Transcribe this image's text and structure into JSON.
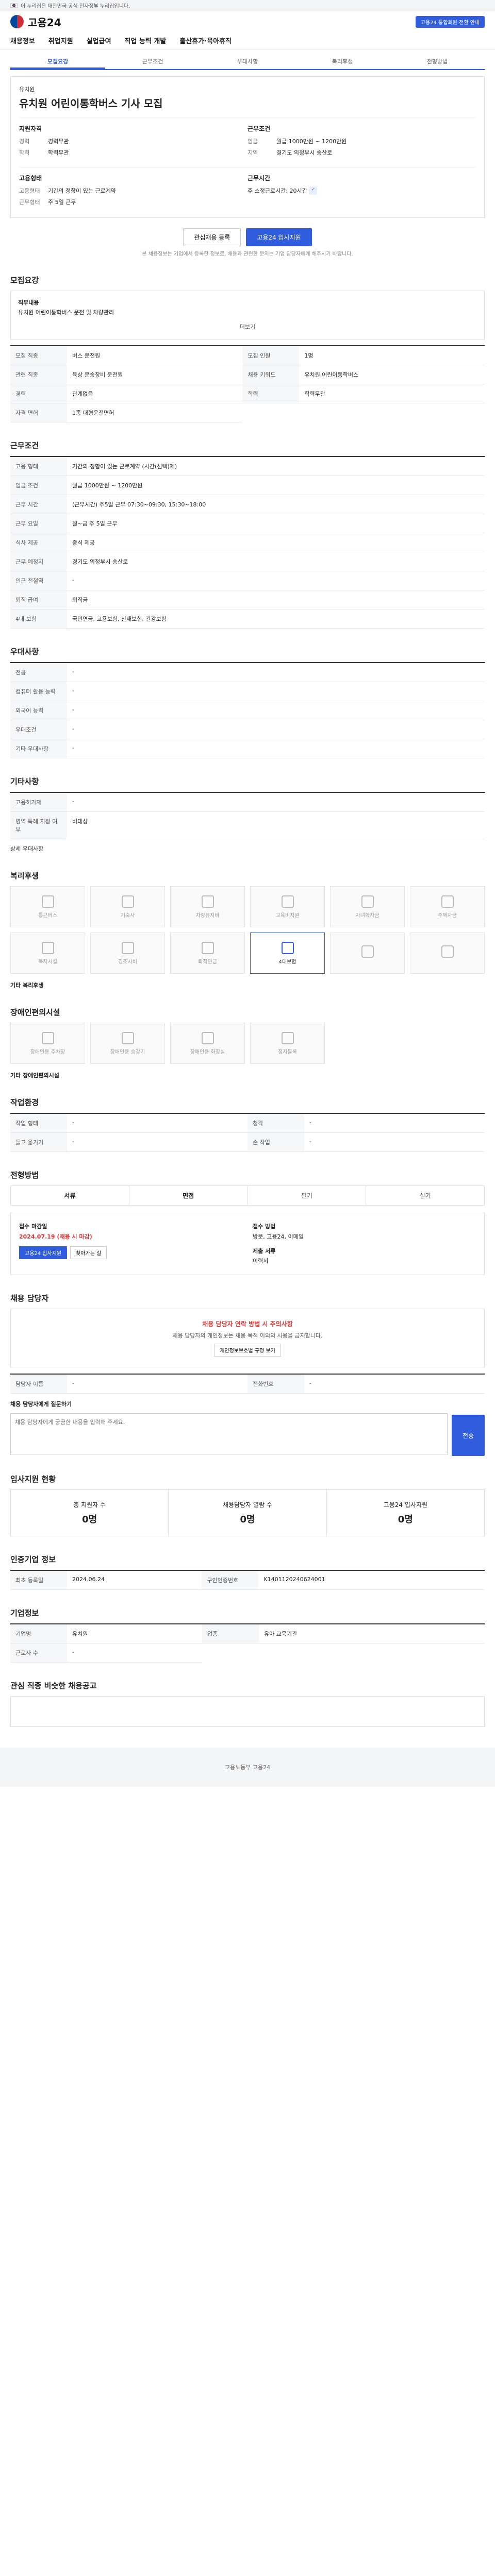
{
  "gov_bar": {
    "text": "이 누리집은 대한민국 공식 전자정부 누리집입니다."
  },
  "header": {
    "logo_text": "고용24",
    "notice": "고용24 통합회원 전환 안내"
  },
  "gnb": [
    "채용정보",
    "취업지원",
    "실업급여",
    "직업 능력 개발",
    "출산휴가·육아휴직"
  ],
  "subtabs": [
    "모집요강",
    "근무조건",
    "우대사항",
    "복리후생",
    "전형방법"
  ],
  "job": {
    "company": "유치원",
    "title": "유치원 어린이통학버스 기사 모집",
    "qualification_head": "지원자격",
    "conditions_head": "근무조건",
    "rows_left": [
      {
        "k": "경력",
        "v": "경력무관"
      },
      {
        "k": "학력",
        "v": "학력무관"
      }
    ],
    "rows_right": [
      {
        "k": "임금",
        "v": "월급 1000만원 ~ 1200만원"
      },
      {
        "k": "지역",
        "v": "경기도 의정부시 송산로"
      }
    ],
    "type_head": "고용형태",
    "type_rows": [
      {
        "k": "고용형태",
        "v": "기간의 정함이 있는 근로계약"
      },
      {
        "k": "근무형태",
        "v": "주 5일 근무"
      }
    ],
    "hours_head": "근무시간",
    "hours_value": "주 소정근로시간: 20시간"
  },
  "actions": {
    "scrap": "관심채용 등록",
    "apply": "고용24 입사지원",
    "note": "본 채용정보는 기업에서 등록한 정보로, 채용과 관련한 문의는 기업 담당자에게 해주시기 바랍니다."
  },
  "recruit": {
    "title": "모집요강",
    "detail_head": "직무내용",
    "detail": "유치원 어린이통학버스 운전 및 차량관리",
    "more": "더보기",
    "table": [
      {
        "k": "모집 직종",
        "v": "버스 운전원"
      },
      {
        "k": "모집 인원",
        "v": "1명"
      },
      {
        "k": "관련 직종",
        "v": "육상 운송장비 운전원"
      },
      {
        "k": "채용 키워드",
        "v": "유치원,어린이통학버스"
      },
      {
        "k": "경력",
        "v": "관계없음"
      },
      {
        "k": "학력",
        "v": "학력무관"
      },
      {
        "k": "자격 면허",
        "v": "1종 대형운전면허"
      }
    ]
  },
  "work": {
    "title": "근무조건",
    "table": [
      {
        "k": "고용 형태",
        "v": "기간의 정함이 있는 근로계약 (시간(선택)제)"
      },
      {
        "k": "임금 조건",
        "v": "월급 1000만원 ~ 1200만원"
      },
      {
        "k": "근무 시간",
        "v": "(근무시간) 주5일 근무 07:30~09:30, 15:30~18:00"
      },
      {
        "k": "근무 요일",
        "v": "월~금 주 5일 근무"
      },
      {
        "k": "식사 제공",
        "v": "중식 제공"
      },
      {
        "k": "근무 예정지",
        "v": "경기도 의정부시 송산로"
      },
      {
        "k": "인근 전철역",
        "v": "-"
      },
      {
        "k": "퇴직 급여",
        "v": "퇴직금"
      },
      {
        "k": "4대 보험",
        "v": "국민연금, 고용보험, 산재보험, 건강보험"
      }
    ]
  },
  "prefer": {
    "title": "우대사항",
    "table": [
      {
        "k": "전공",
        "v": "-"
      },
      {
        "k": "컴퓨터 활용 능력",
        "v": "-"
      },
      {
        "k": "외국어 능력",
        "v": "-"
      },
      {
        "k": "우대조건",
        "v": "-"
      },
      {
        "k": "기타 우대사항",
        "v": "-"
      }
    ]
  },
  "other": {
    "title": "기타사항",
    "table": [
      {
        "k": "고용허가제",
        "v": "-"
      },
      {
        "k": "병역 특례 지정 여부",
        "v": "비대상"
      }
    ],
    "more": "상세 우대사항"
  },
  "welfare": {
    "title": "복리후생",
    "items": [
      {
        "label": "통근버스",
        "on": false
      },
      {
        "label": "기숙사",
        "on": false
      },
      {
        "label": "차량유지비",
        "on": false
      },
      {
        "label": "교육비지원",
        "on": false
      },
      {
        "label": "자녀학자금",
        "on": false
      },
      {
        "label": "주택자금",
        "on": false
      },
      {
        "label": "복지시설",
        "on": false
      },
      {
        "label": "경조사비",
        "on": false
      },
      {
        "label": "퇴직연금",
        "on": false
      },
      {
        "label": "4대보험",
        "on": true
      },
      {
        "label": "",
        "on": false
      },
      {
        "label": "",
        "on": false
      }
    ],
    "etc_label": "기타 복리후생"
  },
  "disabled": {
    "title": "장애인편의시설",
    "items": [
      {
        "label": "장애인용 주차장"
      },
      {
        "label": "장애인용 승강기"
      },
      {
        "label": "장애인용 화장실"
      },
      {
        "label": "점자블록"
      }
    ],
    "etc_label": "기타 장애인편의시설"
  },
  "workenv": {
    "title": "작업환경",
    "table": [
      {
        "k": "작업 형태",
        "v": "-"
      },
      {
        "k": "청각",
        "v": "-"
      },
      {
        "k": "들고 옮기기",
        "v": "-"
      },
      {
        "k": "손 작업",
        "v": "-"
      }
    ]
  },
  "selection": {
    "title": "전형방법",
    "tabs": [
      "서류",
      "면접",
      "필기",
      "실기"
    ],
    "deadline_head": "접수 마감일",
    "deadline": "2024.07.19 (채용 시 마감)",
    "method_head": "접수 방법",
    "method": "방문, 고용24, 이메일",
    "apply_btn": "고용24 입사지원",
    "visit_btn": "찾아가는 길",
    "docs_head": "제출 서류",
    "docs": "이력서"
  },
  "contact": {
    "title": "채용 담당자",
    "warn": "채용 담당자 연락 방법 시 주의사항",
    "desc": "채용 담당자의 개인정보는 채용 목적 이외의 사용을 금지합니다.",
    "link": "개인정보보호법 규정 보기",
    "name_label": "담당자 이름",
    "phone_label": "전화번호",
    "question_label": "채용 담당자에게 질문하기",
    "question_placeholder": "채용 담당자에게 궁금한 내용을 입력해 주세요.",
    "send": "전송"
  },
  "stats": {
    "title": "입사지원 현황",
    "items": [
      {
        "k": "총 지원자 수",
        "v": "0명"
      },
      {
        "k": "채용담당자 열람 수",
        "v": "0명"
      },
      {
        "k": "고용24 입사지원",
        "v": "0명"
      }
    ]
  },
  "certification": {
    "title": "인증기업 정보",
    "table": [
      {
        "k": "최초 등록일",
        "v": "2024.06.24"
      },
      {
        "k": "구인인증번호",
        "v": "K1401120240624001"
      }
    ]
  },
  "company_info": {
    "title": "기업정보",
    "table": [
      {
        "k": "기업명",
        "v": "유치원"
      },
      {
        "k": "업종",
        "v": "유아 교육기관"
      },
      {
        "k": "근로자 수",
        "v": "-"
      }
    ]
  },
  "similar": {
    "title": "관심 직종 비슷한 채용공고"
  },
  "footer": {
    "text": "고용노동부 고용24"
  }
}
